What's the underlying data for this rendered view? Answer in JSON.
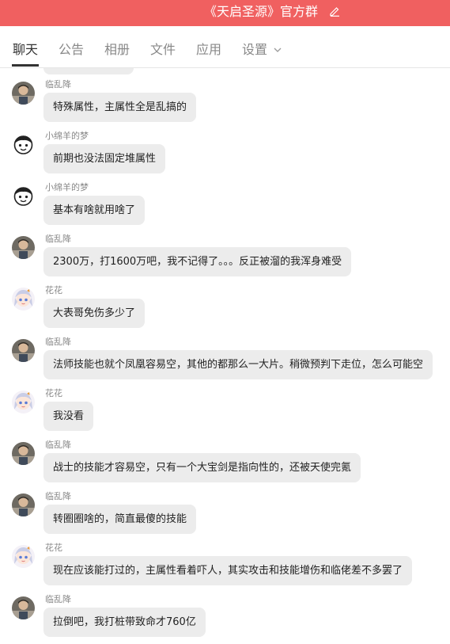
{
  "header": {
    "title": "《天启圣源》官方群"
  },
  "tabs": [
    {
      "label": "聊天"
    },
    {
      "label": "公告"
    },
    {
      "label": "相册"
    },
    {
      "label": "文件"
    },
    {
      "label": "应用"
    },
    {
      "label": "设置"
    }
  ],
  "messages": [
    {
      "sender": "临乱降",
      "avatar": "man-photo",
      "text": "特殊属性，主属性全是乱搞的"
    },
    {
      "sender": "小绵羊的梦",
      "avatar": "cartoon-face",
      "text": "前期也没法固定堆属性"
    },
    {
      "sender": "小绵羊的梦",
      "avatar": "cartoon-face",
      "text": "基本有啥就用啥了"
    },
    {
      "sender": "临乱降",
      "avatar": "man-photo",
      "text": "2300万，打1600万吧，我不记得了。。。反正被溜的我浑身难受"
    },
    {
      "sender": "花花",
      "avatar": "anime-girl",
      "text": "大表哥免伤多少了"
    },
    {
      "sender": "临乱降",
      "avatar": "man-photo",
      "text": "法师技能也就个凤凰容易空，其他的都那么一大片。稍微预判下走位，怎么可能空"
    },
    {
      "sender": "花花",
      "avatar": "anime-girl",
      "text": "我没看"
    },
    {
      "sender": "临乱降",
      "avatar": "man-photo",
      "text": "战士的技能才容易空，只有一个大宝剑是指向性的，还被天使完氪"
    },
    {
      "sender": "临乱降",
      "avatar": "man-photo",
      "text": "转圈圈啥的，简直最傻的技能"
    },
    {
      "sender": "花花",
      "avatar": "anime-girl",
      "text": "现在应该能打过的，主属性看着吓人，其实攻击和技能增伤和临佬差不多罢了"
    },
    {
      "sender": "临乱降",
      "avatar": "man-photo",
      "text": "拉倒吧，我打桩带致命才760亿"
    }
  ],
  "colors": {
    "header_bg": "#f06060",
    "bubble_bg": "#ececec",
    "active_tab": "#333333"
  },
  "icons": [
    "edit-icon",
    "chevron-down-icon"
  ]
}
